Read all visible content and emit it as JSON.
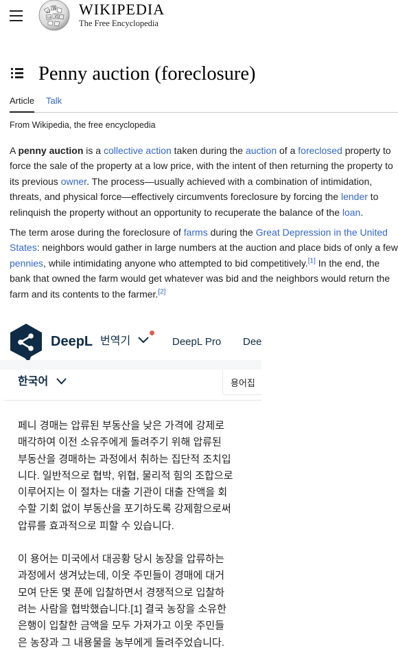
{
  "header": {
    "wordmark_name": "WIKIPEDIA",
    "wordmark_tagline": "The Free Encyclopedia",
    "menu_icon": "hamburger-icon",
    "logo_icon": "wikipedia-globe-logo"
  },
  "article": {
    "title": "Penny auction (foreclosure)",
    "toc_icon": "table-of-contents-icon",
    "tabs": [
      {
        "label": "Article",
        "active": true
      },
      {
        "label": "Talk",
        "active": false
      }
    ],
    "tagline": "From Wikipedia, the free encyclopedia",
    "p1": {
      "t1": "A ",
      "bold": "penny auction",
      "t2": " is a ",
      "l1": "collective action",
      "t3": " taken during the ",
      "l2": "auction",
      "t4": " of a ",
      "l3": "foreclosed",
      "t5": " property to force the sale of the property at a low price, with the intent of then returning the property to its previous ",
      "l4": "owner",
      "t6": ". The process—usually achieved with a combination of intimidation, threats, and physical force—effectively circumvents foreclosure by forcing the ",
      "l5": "lender",
      "t7": " to relinquish the property without an opportunity to recuperate the balance of the ",
      "l6": "loan",
      "t8": "."
    },
    "p2": {
      "t1": "The term arose during the foreclosure of ",
      "l1": "farms",
      "t2": " during the ",
      "l2": "Great Depression in the United States",
      "t3": ": neighbors would gather in large numbers at the auction and place bids of only a few ",
      "l3": "pennies",
      "t4": ", while intimidating anyone who attempted to bid competitively.",
      "ref1": "[1]",
      "t5": " In the end, the bank that owned the farm would get whatever was bid and the neighbors would return the farm and its contents to the farmer.",
      "ref2": "[2]"
    }
  },
  "deepl": {
    "brand": "DeepL",
    "brand_sub": "번역기",
    "pro_label": "DeepL Pro",
    "cut_label": "Dee",
    "source_language": "한국어",
    "glossary_label": "용어집",
    "notification_color": "#e05a5a",
    "translation_p1": "페니 경매는 압류된 부동산을 낮은 가격에 강제로\n매각하여 이전 소유주에게 돌려주기 위해 압류된\n부동산을 경매하는 과정에서 취하는 집단적 조치입\n니다. 일반적으로 협박, 위협, 물리적 힘의 조합으로\n이루어지는 이 절차는 대출 기관이 대출 잔액을 회\n수할 기회 없이 부동산을 포기하도록 강제함으로써\n압류를 효과적으로 피할 수 있습니다.",
    "translation_p2": "이 용어는 미국에서 대공황 당시 농장을 압류하는\n과정에서 생겨났는데, 이웃 주민들이 경매에 대거\n모여 단돈 몇 푼에 입찰하면서 경쟁적으로 입찰하\n려는 사람을 협박했습니다.[1] 결국 농장을 소유한\n은행이 입찰한 금액을 모두 가져가고 이웃 주민들\n은 농장과 그 내용물을 농부에게 돌려주었습니다."
  }
}
